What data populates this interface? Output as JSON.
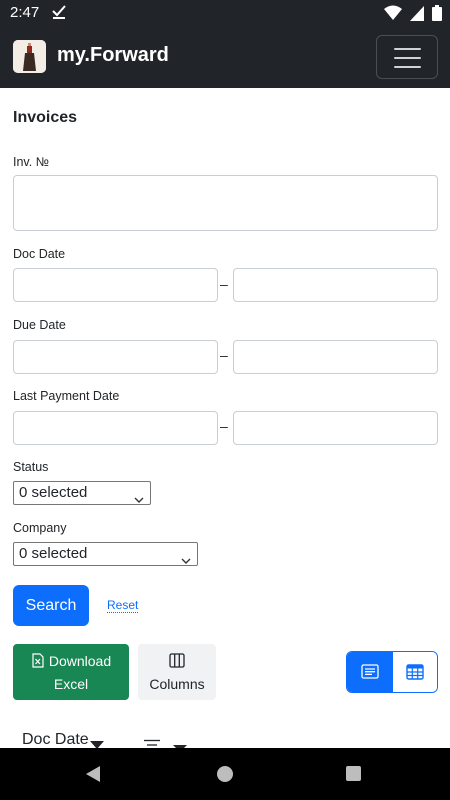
{
  "status_bar": {
    "time": "2:47"
  },
  "navbar": {
    "brand": "my.Forward"
  },
  "form": {
    "title": "Invoices",
    "invoice_number": {
      "label": "Inv. №",
      "value": ""
    },
    "doc_date": {
      "label": "Doc Date",
      "from": "",
      "to": ""
    },
    "due_date": {
      "label": "Due Date",
      "from": "",
      "to": ""
    },
    "last_payment_date": {
      "label": "Last Payment Date",
      "from": "",
      "to": ""
    },
    "range_separator": "–",
    "status": {
      "label": "Status",
      "selected": "0 selected"
    },
    "company": {
      "label": "Company",
      "selected": "0 selected"
    },
    "search_button": "Search",
    "reset_link": "Reset"
  },
  "toolbar": {
    "download_excel_line1": "Download",
    "download_excel_line2": "Excel",
    "columns_label": "Columns"
  },
  "table": {
    "headers": [
      "Doc Date"
    ]
  },
  "colors": {
    "navbar": "#212529",
    "primary": "#0d6efd",
    "success": "#198754"
  }
}
